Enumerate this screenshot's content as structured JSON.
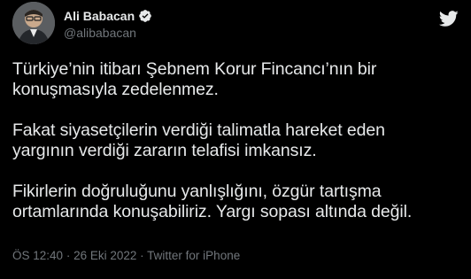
{
  "author": {
    "display_name": "Ali Babacan",
    "handle": "@alibabacan",
    "verified_badge_color": "#e7e9ea",
    "avatar_icon": "profile-photo"
  },
  "app_logo_icon": "twitter-bird-icon",
  "tweet": {
    "paragraphs": [
      "Türkiye’nin itibarı Şebnem Korur Fincancı’nın bir\nkonuşmasıyla zedelenmez.",
      "Fakat siyasetçilerin verdiği talimatla hareket eden\nyargının verdiği zararın telafisi imkansız.",
      "Fikirlerin doğruluğunu yanlışlığını, özgür tartışma\nortamlarında konuşabiliriz. Yargı sopası altında değil."
    ]
  },
  "meta": {
    "time": "ÖS 12:40",
    "separator": "·",
    "date": "26 Eki 2022",
    "source": "Twitter for iPhone"
  },
  "colors": {
    "background": "#000000",
    "text": "#e7e9ea",
    "secondary_text": "#71767b"
  }
}
